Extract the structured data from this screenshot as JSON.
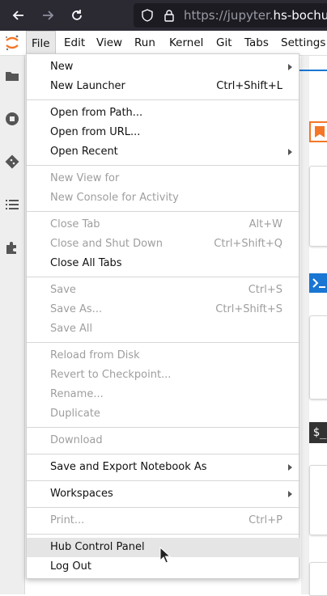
{
  "browser": {
    "url_scheme": "https://jupyter.",
    "url_host": "hs-bochum."
  },
  "menubar": {
    "items": [
      "File",
      "Edit",
      "View",
      "Run",
      "Kernel",
      "Git",
      "Tabs",
      "Settings"
    ],
    "active": "File"
  },
  "file_menu": {
    "items": [
      {
        "label": "New",
        "shortcut": "",
        "submenu": true,
        "disabled": false
      },
      {
        "label": "New Launcher",
        "shortcut": "Ctrl+Shift+L",
        "submenu": false,
        "disabled": false
      },
      {
        "label": "Open from Path...",
        "shortcut": "",
        "submenu": false,
        "disabled": false
      },
      {
        "label": "Open from URL...",
        "shortcut": "",
        "submenu": false,
        "disabled": false
      },
      {
        "label": "Open Recent",
        "shortcut": "",
        "submenu": true,
        "disabled": false
      },
      {
        "label": "New View for",
        "shortcut": "",
        "submenu": false,
        "disabled": true
      },
      {
        "label": "New Console for Activity",
        "shortcut": "",
        "submenu": false,
        "disabled": true
      },
      {
        "label": "Close Tab",
        "shortcut": "Alt+W",
        "submenu": false,
        "disabled": true
      },
      {
        "label": "Close and Shut Down",
        "shortcut": "Ctrl+Shift+Q",
        "submenu": false,
        "disabled": true
      },
      {
        "label": "Close All Tabs",
        "shortcut": "",
        "submenu": false,
        "disabled": false
      },
      {
        "label": "Save",
        "shortcut": "Ctrl+S",
        "submenu": false,
        "disabled": true
      },
      {
        "label": "Save As...",
        "shortcut": "Ctrl+Shift+S",
        "submenu": false,
        "disabled": true
      },
      {
        "label": "Save All",
        "shortcut": "",
        "submenu": false,
        "disabled": true
      },
      {
        "label": "Reload from Disk",
        "shortcut": "",
        "submenu": false,
        "disabled": true
      },
      {
        "label": "Revert to Checkpoint...",
        "shortcut": "",
        "submenu": false,
        "disabled": true
      },
      {
        "label": "Rename...",
        "shortcut": "",
        "submenu": false,
        "disabled": true
      },
      {
        "label": "Duplicate",
        "shortcut": "",
        "submenu": false,
        "disabled": true
      },
      {
        "label": "Download",
        "shortcut": "",
        "submenu": false,
        "disabled": true
      },
      {
        "label": "Save and Export Notebook As",
        "shortcut": "",
        "submenu": true,
        "disabled": false
      },
      {
        "label": "Workspaces",
        "shortcut": "",
        "submenu": true,
        "disabled": false
      },
      {
        "label": "Print...",
        "shortcut": "Ctrl+P",
        "submenu": false,
        "disabled": true
      },
      {
        "label": "Hub Control Panel",
        "shortcut": "",
        "submenu": false,
        "disabled": false,
        "highlighted": true
      },
      {
        "label": "Log Out",
        "shortcut": "",
        "submenu": false,
        "disabled": false
      }
    ]
  },
  "sidebar": {
    "icons": [
      "folder-icon",
      "running-icon",
      "git-icon",
      "toc-icon",
      "extension-icon"
    ]
  },
  "background": {
    "terminal_prompt": "$_"
  },
  "colors": {
    "accent": "#1976d2",
    "logo": "#f37726",
    "browser_bar": "#2b2a33"
  }
}
